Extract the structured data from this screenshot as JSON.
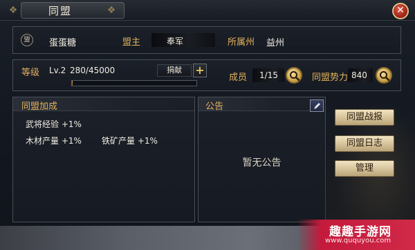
{
  "window": {
    "title": "同盟"
  },
  "header": {
    "emblem": "盟",
    "alliance_name": "蛋蛋糖",
    "leader_label": "盟主",
    "leader_name": "奉军",
    "state_label": "所属州",
    "state_value": "益州"
  },
  "stats": {
    "level_label": "等级",
    "level_value": "Lv.2",
    "exp_text": "280/45000",
    "exp_progress": 0.0062,
    "donate_label": "捐献",
    "members_label": "成员",
    "members_value": "1/15",
    "power_label": "同盟势力",
    "power_value": "840"
  },
  "bonus": {
    "title": "同盟加成",
    "items": [
      {
        "text": "武将经验 +1%"
      },
      {
        "text": "木材产量 +1%"
      },
      {
        "text": "铁矿产量 +1%"
      }
    ]
  },
  "notice": {
    "title": "公告",
    "empty_text": "暂无公告"
  },
  "actions": {
    "battle_report": "同盟战报",
    "log": "同盟日志",
    "manage": "管理"
  },
  "watermark": {
    "title": "趣趣手游网",
    "url": "www.ququyou.com"
  },
  "icons": {
    "close": "close-icon",
    "search": "search-icon",
    "edit": "pencil-icon",
    "plus": "plus-icon"
  },
  "colors": {
    "gold_label": "#e3b15d",
    "close_red": "#c0392b",
    "button_cream": "#e0cfa6"
  }
}
